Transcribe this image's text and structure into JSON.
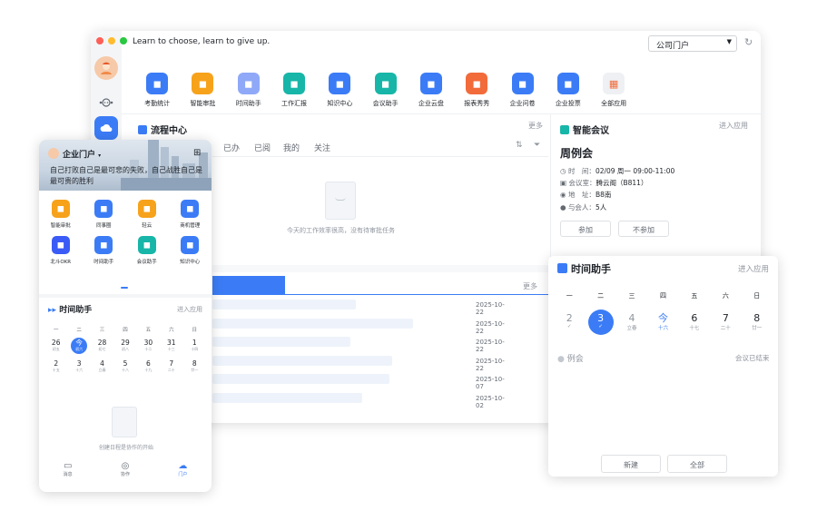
{
  "window": {
    "motto": "Learn to choose, learn to give up.",
    "portal_select": "公司门户",
    "apps": [
      {
        "label": "考勤统计",
        "icon": "clock-icon",
        "color": "#3b7cf6"
      },
      {
        "label": "智能审批",
        "icon": "approval-icon",
        "color": "#f7a21b"
      },
      {
        "label": "时间助手",
        "icon": "calendar-check-icon",
        "color": "#8fa9f8"
      },
      {
        "label": "工作汇报",
        "icon": "report-icon",
        "color": "#17b6a8"
      },
      {
        "label": "知识中心",
        "icon": "book-icon",
        "color": "#3b7cf6"
      },
      {
        "label": "会议助手",
        "icon": "meeting-icon",
        "color": "#17b6a8"
      },
      {
        "label": "企业云盘",
        "icon": "folder-icon",
        "color": "#3b7cf6"
      },
      {
        "label": "报表秀秀",
        "icon": "chart-line-icon",
        "color": "#f26b3a"
      },
      {
        "label": "企业问卷",
        "icon": "survey-icon",
        "color": "#3b7cf6"
      },
      {
        "label": "企业投票",
        "icon": "bar-chart-icon",
        "color": "#3b7cf6"
      },
      {
        "label": "全部应用",
        "icon": "grid-apps-icon",
        "color": "#eef0f3"
      }
    ],
    "process": {
      "title": "流程中心",
      "more": "更多",
      "tabs": [
        "已办",
        "已阅",
        "我的",
        "关注"
      ],
      "empty_text": "今天的工作效率很高，没有待审批任务"
    },
    "list": {
      "more": "更多",
      "dates": [
        "2025-10-22",
        "2025-10-22",
        "2025-10-22",
        "2025-10-22",
        "2025-10-07",
        "2025-10-02"
      ],
      "bar_widths": [
        0.48,
        0.67,
        0.46,
        0.6,
        0.59,
        0.5
      ]
    },
    "meeting": {
      "title": "智能会议",
      "enter": "进入应用",
      "name": "周例会",
      "time_label": "时　间：",
      "time_value": "02/09 周一 09:00-11:00",
      "room_label": "会议室：",
      "room_value": "腾云阁（B811）",
      "addr_label": "地　址：",
      "addr_value": "B8南",
      "people_label": "与会人：",
      "people_value": "5人",
      "join": "参加",
      "decline": "不参加"
    }
  },
  "mobile": {
    "title": "企业门户",
    "quote": "自己打败自己是最可悲的失败，自己战胜自己是最可贵的胜利",
    "apps": [
      {
        "label": "智能审批",
        "icon": "approval-icon",
        "color": "#f7a21b"
      },
      {
        "label": "同事圈",
        "icon": "circle-icon",
        "color": "#3b7cf6"
      },
      {
        "label": "轻云",
        "icon": "cloud-icon",
        "color": "#f7a21b"
      },
      {
        "label": "商机管理",
        "icon": "user-icon",
        "color": "#3b7cf6"
      },
      {
        "label": "北斗OKR",
        "icon": "target-icon",
        "color": "#3b5bf6"
      },
      {
        "label": "时间助手",
        "icon": "calendar-check-icon",
        "color": "#3b7cf6"
      },
      {
        "label": "会议助手",
        "icon": "meeting-icon",
        "color": "#17b6a8"
      },
      {
        "label": "知识中心",
        "icon": "book-icon",
        "color": "#3b7cf6"
      }
    ],
    "time": {
      "title": "时间助手",
      "enter": "进入应用",
      "weekdays": [
        "一",
        "二",
        "三",
        "四",
        "五",
        "六",
        "日"
      ],
      "week1": [
        {
          "d": "26",
          "s": "初五"
        },
        {
          "d": "今",
          "s": "初六"
        },
        {
          "d": "28",
          "s": "初七"
        },
        {
          "d": "29",
          "s": "初八"
        },
        {
          "d": "30",
          "s": "十二"
        },
        {
          "d": "31",
          "s": "十三"
        },
        {
          "d": "1",
          "s": "十四"
        }
      ],
      "week2": [
        {
          "d": "2",
          "s": "十五"
        },
        {
          "d": "3",
          "s": "十六"
        },
        {
          "d": "4",
          "s": "立春"
        },
        {
          "d": "5",
          "s": "十八"
        },
        {
          "d": "6",
          "s": "十九"
        },
        {
          "d": "7",
          "s": "二十"
        },
        {
          "d": "8",
          "s": "廿一"
        }
      ],
      "empty_text": "创建日程是协作的开始"
    },
    "tabbar": [
      "消息",
      "协作",
      "门户"
    ]
  },
  "panel": {
    "title": "时间助手",
    "enter": "进入应用",
    "weekdays": [
      "一",
      "二",
      "三",
      "四",
      "五",
      "六",
      "日"
    ],
    "days": [
      {
        "d": "2",
        "s": "✓"
      },
      {
        "d": "3",
        "s": "✓"
      },
      {
        "d": "4",
        "s": "立春"
      },
      {
        "d": "今",
        "s": "十六"
      },
      {
        "d": "6",
        "s": "十七"
      },
      {
        "d": "7",
        "s": "二十"
      },
      {
        "d": "8",
        "s": "廿一"
      }
    ],
    "event": "例会",
    "event_status": "会议已结束",
    "new_button": "新建",
    "all_button": "全部"
  }
}
